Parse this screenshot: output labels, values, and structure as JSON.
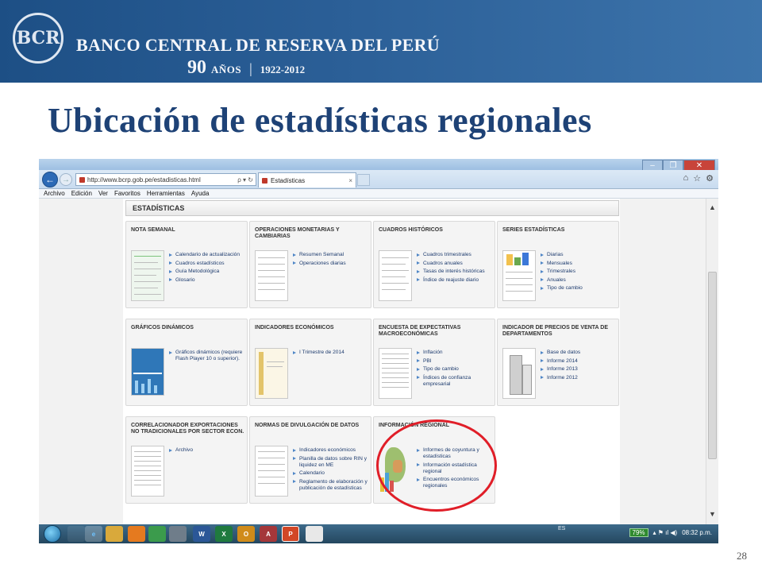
{
  "slide": {
    "bank_name": "BANCO CENTRAL DE RESERVA DEL PERÚ",
    "seal_letters": "BCR",
    "anniversary_number": "90",
    "anniversary_word": "AÑOS",
    "anniversary_sep": "|",
    "anniversary_years": "1922-2012",
    "title": "Ubicación de estadísticas regionales",
    "page_number": "28"
  },
  "browser": {
    "url": "http://www.bcrp.gob.pe/estadisticas.html",
    "address_tools": "ρ ▾ ↻",
    "tab_title": "Estadísticas",
    "tab_close": "×",
    "back_symbol": "←",
    "forward_symbol": "→",
    "window_controls": {
      "minimize": "–",
      "restore": "❐",
      "close": "✕"
    },
    "toolbar_icons": {
      "home": "⌂",
      "favorites": "☆",
      "settings": "⚙"
    },
    "menu": [
      "Archivo",
      "Edición",
      "Ver",
      "Favoritos",
      "Herramientas",
      "Ayuda"
    ],
    "scroll_up": "▲",
    "scroll_down": "▼"
  },
  "page": {
    "header": "ESTADÍSTICAS",
    "cards": [
      {
        "title": "NOTA SEMANAL",
        "links": [
          "Calendario de actualización",
          "Cuadros estadísticos",
          "Guía Metodológica",
          "Glosario"
        ]
      },
      {
        "title": "OPERACIONES MONETARIAS Y CAMBIARIAS",
        "links": [
          "Resumen Semanal",
          "Operaciones diarias"
        ]
      },
      {
        "title": "CUADROS HISTÓRICOS",
        "links": [
          "Cuadros trimestrales",
          "Cuadros anuales",
          "Tasas de interés históricas",
          "Índice de reajuste diario"
        ]
      },
      {
        "title": "SERIES ESTADÍSTICAS",
        "links": [
          "Diarias",
          "Mensuales",
          "Trimestrales",
          "Anuales",
          "Tipo de cambio"
        ]
      },
      {
        "title": "GRÁFICOS DINÁMICOS",
        "links": [
          "Gráficos dinámicos (requiere Flash Player 10 o superior)."
        ]
      },
      {
        "title": "INDICADORES ECONÓMICOS",
        "links": [
          "I Trimestre de 2014"
        ]
      },
      {
        "title": "ENCUESTA DE EXPECTATIVAS MACROECONÓMICAS",
        "links": [
          "Inflación",
          "PBI",
          "Tipo de cambio",
          "Índices de confianza empresarial"
        ]
      },
      {
        "title": "INDICADOR DE PRECIOS DE VENTA DE DEPARTAMENTOS",
        "links": [
          "Base de datos",
          "Informe 2014",
          "Informe 2013",
          "Informe 2012"
        ]
      },
      {
        "title": "CORRELACIONADOR EXPORTACIONES NO TRADICIONALES POR SECTOR ECON.",
        "links": [
          "Archivo"
        ]
      },
      {
        "title": "NORMAS DE DIVULGACIÓN DE DATOS",
        "links": [
          "Indicadores económicos",
          "Planilla de datos sobre RIN y liquidez en ME",
          "Calendario",
          "Reglamento de elaboración y publicación de estadísticas"
        ]
      },
      {
        "title": "INFORMACIÓN REGIONAL",
        "links": [
          "Informes de coyuntura y estadísticas",
          "Información estadística regional",
          "Encuentros económicos regionales"
        ]
      }
    ]
  },
  "taskbar": {
    "apps": [
      "",
      "",
      "",
      "",
      "",
      "W",
      "X",
      "O",
      "A",
      "P"
    ],
    "language": "ES",
    "battery": "79%",
    "time": "08:32 p.m.",
    "tray_icons": "▴ ⚑ ıl ◀)"
  },
  "colors": {
    "title": "#1e4276",
    "banner": "#2b5f97",
    "highlight": "#e01e28",
    "link": "#1d3b6e"
  }
}
